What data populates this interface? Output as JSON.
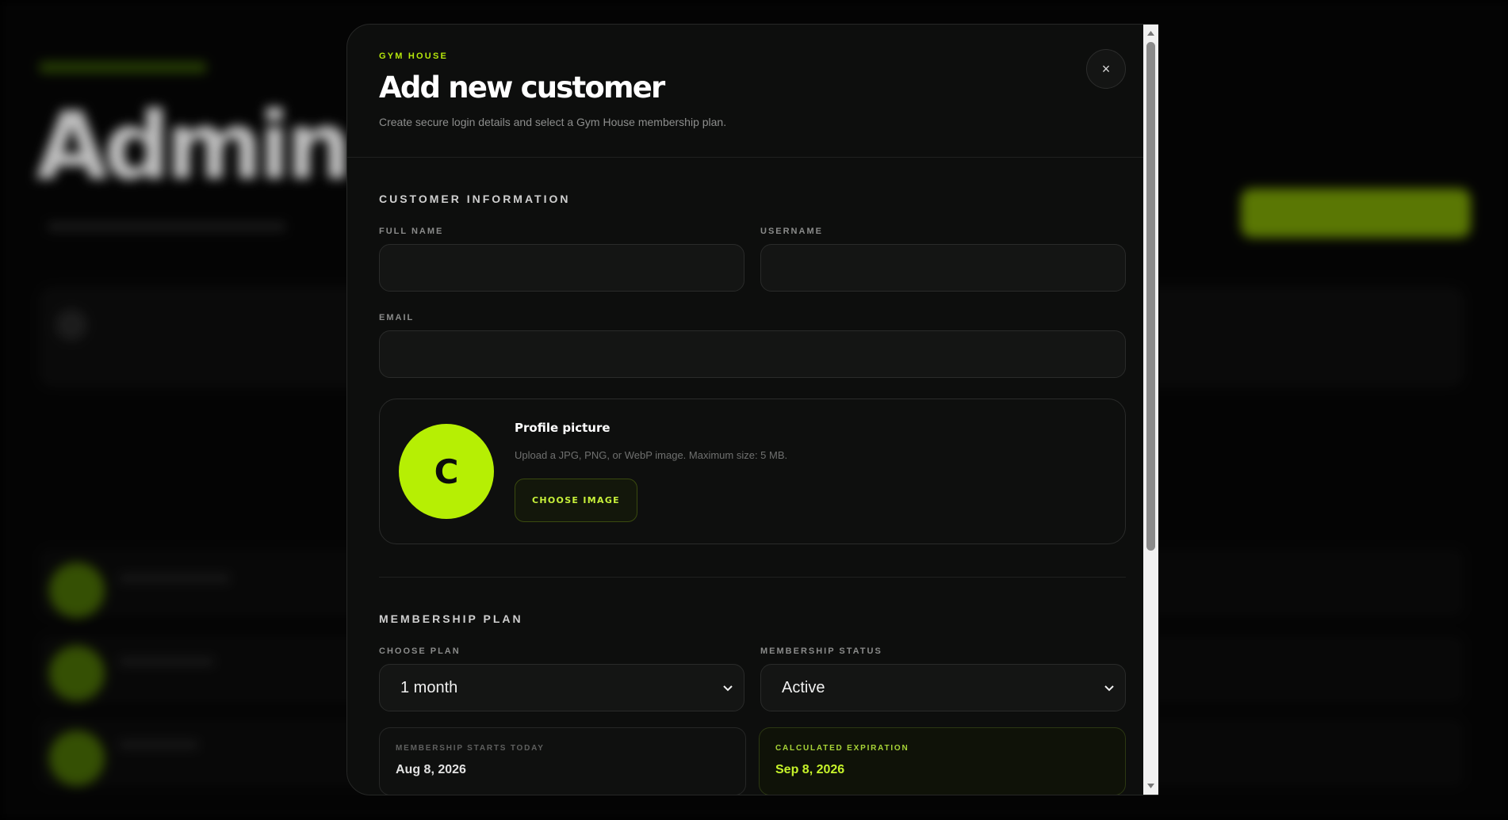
{
  "modal": {
    "brand": "GYM HOUSE",
    "title": "Add new customer",
    "subtitle": "Create secure login details and select a Gym House membership plan.",
    "close_icon": "×"
  },
  "customer_info": {
    "section_title": "CUSTOMER INFORMATION",
    "full_name_label": "FULL NAME",
    "full_name_value": "",
    "username_label": "USERNAME",
    "username_value": "",
    "email_label": "EMAIL",
    "email_value": ""
  },
  "profile_picture": {
    "avatar_initial": "C",
    "title": "Profile picture",
    "hint": "Upload a JPG, PNG, or WebP image. Maximum size: 5 MB.",
    "button_label": "CHOOSE IMAGE"
  },
  "membership": {
    "section_title": "MEMBERSHIP PLAN",
    "plan_label": "CHOOSE PLAN",
    "plan_value": "1 month",
    "status_label": "MEMBERSHIP STATUS",
    "status_value": "Active",
    "start_label": "MEMBERSHIP STARTS TODAY",
    "start_value": "Aug 8, 2026",
    "expiration_label": "CALCULATED EXPIRATION",
    "expiration_value": "Sep 8, 2026"
  },
  "colors": {
    "accent": "#b6ef04",
    "background": "#0d0e0d"
  },
  "icons": {
    "close": "close-icon",
    "chevron": "chevron-down-icon",
    "scroll_up": "scroll-up-arrow-icon",
    "scroll_down": "scroll-down-arrow-icon"
  }
}
